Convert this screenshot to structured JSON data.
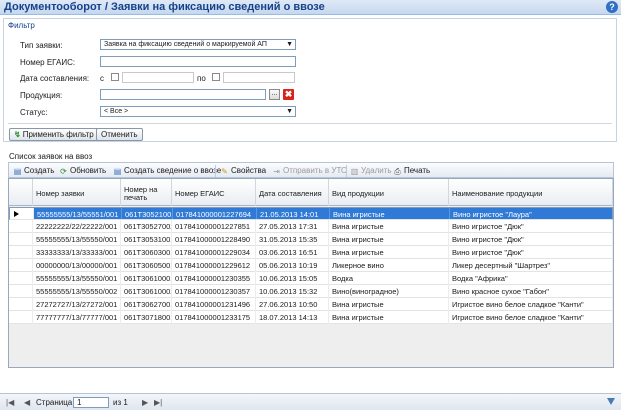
{
  "window": {
    "title": "Документооборот / Заявки на фиксацию сведений о ввозе",
    "help_label": "?"
  },
  "filter": {
    "legend": "Фильтр",
    "type_label": "Тип заявки:",
    "type_value": "Заявка на фиксацию сведений о маркируемой АП",
    "egais_label": "Номер ЕГАИС:",
    "egais_value": "",
    "date_label": "Дата составления:",
    "date_from_label": "с",
    "date_to_label": "по",
    "product_label": "Продукция:",
    "product_value": "",
    "product_select_label": "...",
    "product_clear_label": "✖",
    "status_label": "Статус:",
    "status_value": "< Все >",
    "apply_label": "Применить фильтр",
    "cancel_label": "Отменить"
  },
  "list": {
    "label": "Список заявок на ввоз"
  },
  "toolbar": {
    "create": "Создать",
    "refresh": "Обновить",
    "create_info": "Создать сведение о ввозе",
    "properties": "Свойства",
    "send": "Отправить в УТО",
    "delete": "Удалить",
    "print": "Печать"
  },
  "grid": {
    "columns": [
      "Номер заявки",
      "Номер на печать",
      "Номер ЕГАИС",
      "Дата составления",
      "Вид продукции",
      "Наименование продукции"
    ],
    "rows": [
      [
        "55555555/13/55551/001",
        "061T30521001",
        "017841000001227694",
        "21.05.2013 14:01",
        "Вина игристые",
        "Вино игристое \"Лаура\""
      ],
      [
        "22222222/22/22222/001",
        "061T30527002",
        "017841000001227851",
        "27.05.2013 17:31",
        "Вина игристые",
        "Вино игристое \"Дюк\""
      ],
      [
        "55555555/13/55550/001",
        "061T30531001",
        "017841000001228490",
        "31.05.2013 15:35",
        "Вина игристые",
        "Вино игристое \"Дюк\""
      ],
      [
        "33333333/13/33333/001",
        "061T30603001",
        "017841000001229034",
        "03.06.2013 16:51",
        "Вина игристые",
        "Вино игристое \"Дюк\""
      ],
      [
        "00000000/13/00000/001",
        "061T30605001",
        "017841000001229612",
        "05.06.2013 10:19",
        "Ликерное вино",
        "Ликер десертный \"Шартрез\""
      ],
      [
        "55555555/13/55550/001",
        "061T30610001",
        "017841000001230355",
        "10.06.2013 15:05",
        "Водка",
        "Водка \"Африка\""
      ],
      [
        "55555555/13/55550/002",
        "061T30610002",
        "017841000001230357",
        "10.06.2013 15:32",
        "Вино(виноградное)",
        "Вино красное сухое \"Габон\""
      ],
      [
        "27272727/13/27272/001",
        "061T30627001",
        "017841000001231496",
        "27.06.2013 10:50",
        "Вина игристые",
        "Игристое вино белое сладкое \"Канти\""
      ],
      [
        "77777777/13/77777/001",
        "061T30718001",
        "017841000001233175",
        "18.07.2013 14:13",
        "Вина игристые",
        "Игристое вино белое сладкое \"Канти\""
      ]
    ],
    "selected_row": 0
  },
  "pager": {
    "page_label": "Страница",
    "page_value": "1",
    "of_label": "из 1",
    "first": "|◀",
    "prev": "◀",
    "next": "▶",
    "last": "▶|"
  }
}
